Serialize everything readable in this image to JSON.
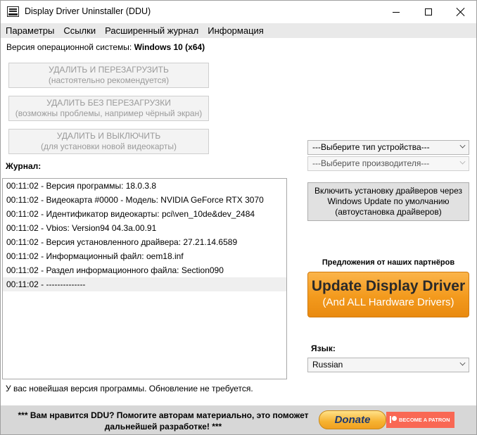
{
  "window": {
    "title": "Display Driver Uninstaller (DDU)"
  },
  "menu": [
    {
      "label": "Параметры"
    },
    {
      "label": "Ссылки"
    },
    {
      "label": "Расширенный журнал"
    },
    {
      "label": "Информация"
    }
  ],
  "os": {
    "label": "Версия операционной системы:",
    "value": "Windows 10 (x64)"
  },
  "actions": [
    {
      "title": "УДАЛИТЬ И ПЕРЕЗАГРУЗИТЬ",
      "subtitle": "(настоятельно рекомендуется)"
    },
    {
      "title": "УДАЛИТЬ БЕЗ ПЕРЕЗАГРУЗКИ",
      "subtitle": "(возможны проблемы, например чёрный экран)"
    },
    {
      "title": "УДАЛИТЬ И ВЫКЛЮЧИТЬ",
      "subtitle": "(для установки новой видеокарты)"
    }
  ],
  "journal": {
    "label": "Журнал:",
    "entries": [
      "00:11:02 - Версия программы: 18.0.3.8",
      "00:11:02 - Видеокарта #0000 - Модель: NVIDIA GeForce RTX 3070",
      "00:11:02 - Идентификатор видеокарты: pci\\ven_10de&dev_2484",
      "00:11:02 - Vbios: Version94 04.3a.00.91",
      "00:11:02 - Версия установленного драйвера: 27.21.14.6589",
      "00:11:02 - Информационный файл: oem18.inf",
      "00:11:02 - Раздел информационного файла: Section090",
      "00:11:02 - --------------"
    ]
  },
  "device_type": {
    "value": "---Выберите тип устройства---"
  },
  "vendor": {
    "value": "---Выберите производителя---"
  },
  "enable_updates": {
    "line1": "Включить установку драйверов через",
    "line2": "Windows Update по умолчанию",
    "line3": "(автоустановка драйверов)"
  },
  "partners": {
    "label": "Предложения от наших партнёров"
  },
  "ad": {
    "line1": "Update Display Driver",
    "line2": "(And ALL Hardware Drivers)"
  },
  "language": {
    "label": "Язык:",
    "value": "Russian"
  },
  "status": "У вас новейшая версия программы. Обновление не требуется.",
  "footer": {
    "line1": "*** Вам нравится DDU? Помогите авторам материально, это поможет",
    "line2": "дальнейшей разработке! ***",
    "donate": "Donate",
    "patron": "BECOME A PATRON"
  },
  "colors": {
    "ad_orange": "#f39a1d",
    "patreon": "#f96854",
    "menubar": "#e9e9e9",
    "footer": "#d7d7d7"
  }
}
